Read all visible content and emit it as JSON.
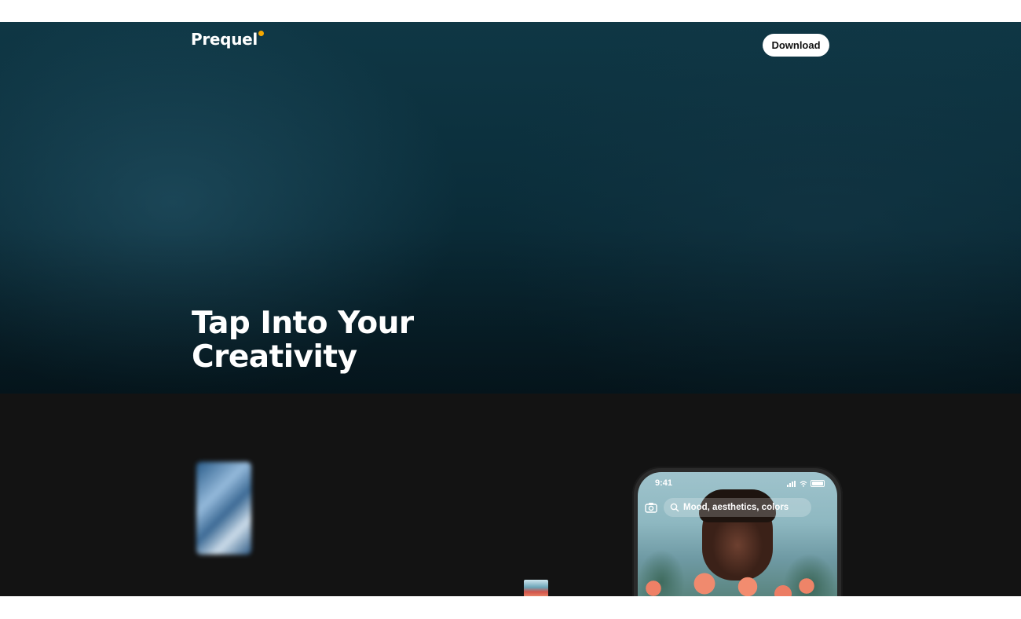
{
  "header": {
    "logo_text": "Prequel",
    "download_label": "Download"
  },
  "hero": {
    "title_line1": "Tap Into Your",
    "title_line2": "Creativity"
  },
  "phone": {
    "time": "9:41",
    "search_placeholder": "Mood, aesthetics, colors"
  },
  "colors": {
    "logo_dot": "#f5a800",
    "hero_bg": "#0f3745",
    "section_bg": "#131313",
    "button_bg": "#ffffff"
  },
  "icons": [
    "camera-icon",
    "search-icon",
    "signal-icon",
    "wifi-icon",
    "battery-icon"
  ]
}
